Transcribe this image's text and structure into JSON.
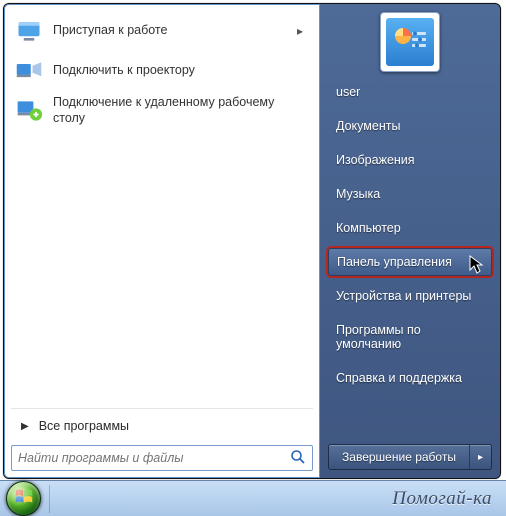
{
  "left": {
    "items": [
      {
        "label": "Приступая к работе",
        "has_submenu": true
      },
      {
        "label": "Подключить к проектору",
        "has_submenu": false
      },
      {
        "label": "Подключение к удаленному рабочему столу",
        "has_submenu": false
      }
    ],
    "all_programs": "Все программы",
    "search_placeholder": "Найти программы и файлы"
  },
  "right": {
    "user": "user",
    "items": [
      "Документы",
      "Изображения",
      "Музыка",
      "Компьютер",
      "Панель управления",
      "Устройства и принтеры",
      "Программы по умолчанию",
      "Справка и поддержка"
    ],
    "highlight_index": 4,
    "shutdown_label": "Завершение работы"
  },
  "watermark": "Помогай-ка"
}
